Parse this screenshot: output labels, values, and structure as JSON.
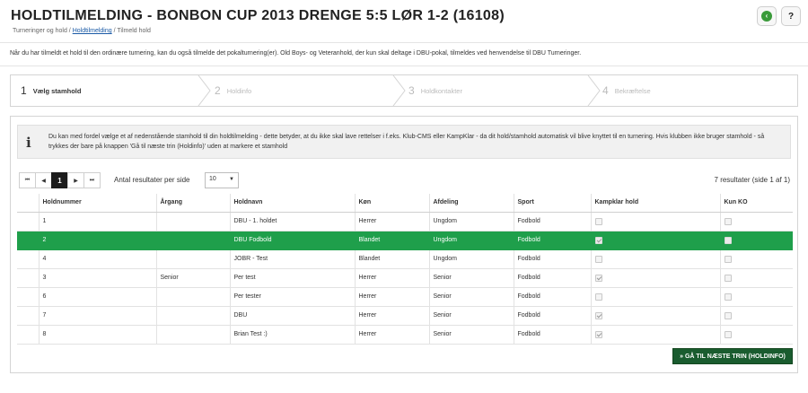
{
  "title": "HOLDTILMELDING - BONBON CUP 2013 DRENGE 5:5 LØR 1-2 (16108)",
  "breadcrumb": {
    "part1": "Turneringer og hold",
    "sep1": " / ",
    "link": "Holdtilmelding",
    "sep2": " / ",
    "current": "Tilmeld hold"
  },
  "top_buttons": {
    "back_icon": "back-arrow-icon",
    "help": "?"
  },
  "info_text": "Når du har tilmeldt et hold til den ordinære turnering, kan du også tilmelde det pokalturnering(er). Old Boys- og Veteranhold, der kun skal deltage i DBU-pokal, tilmeldes ved henvendelse til DBU Turneringer.",
  "wizard": {
    "steps": [
      {
        "num": "1",
        "label": "Vælg stamhold",
        "active": true
      },
      {
        "num": "2",
        "label": "Holdinfo",
        "active": false
      },
      {
        "num": "3",
        "label": "Holdkontakter",
        "active": false
      },
      {
        "num": "4",
        "label": "Bekræftelse",
        "active": false
      }
    ]
  },
  "notice": {
    "icon": "info-icon",
    "text": "Du kan med fordel vælge et af nedenstående stamhold til din holdtilmelding - dette betyder, at du ikke skal lave rettelser i f.eks. Klub-CMS eller KampKlar - da dit hold/stamhold automatisk vil blive knyttet til en turnering. Hvis klubben ikke bruger stamhold - så trykkes der bare på knappen 'Gå til næste trin (Holdinfo)' uden at markere et stamhold"
  },
  "pager": {
    "first": "⏮",
    "prev": "◀",
    "current": "1",
    "next": "▶",
    "last": "⏭",
    "per_page_label": "Antal resultater per side",
    "per_page_value": "10",
    "results": "7 resultater (side 1 af 1)"
  },
  "table": {
    "columns": [
      "Holdnummer",
      "Årgang",
      "Holdnavn",
      "Køn",
      "Afdeling",
      "Sport",
      "Kampklar hold",
      "Kun KO"
    ],
    "rows": [
      {
        "holdnummer": "1",
        "argang": "",
        "holdnavn": "DBU - 1. holdet",
        "kon": "Herrer",
        "afdeling": "Ungdom",
        "sport": "Fodbold",
        "kampklar": false,
        "kunko": false,
        "selected": false
      },
      {
        "holdnummer": "2",
        "argang": "",
        "holdnavn": "DBU Fodbold",
        "kon": "Blandet",
        "afdeling": "Ungdom",
        "sport": "Fodbold",
        "kampklar": true,
        "kunko": false,
        "selected": true
      },
      {
        "holdnummer": "4",
        "argang": "",
        "holdnavn": "JOBR - Test",
        "kon": "Blandet",
        "afdeling": "Ungdom",
        "sport": "Fodbold",
        "kampklar": false,
        "kunko": false,
        "selected": false
      },
      {
        "holdnummer": "3",
        "argang": "Senior",
        "holdnavn": "Per test",
        "kon": "Herrer",
        "afdeling": "Senior",
        "sport": "Fodbold",
        "kampklar": true,
        "kunko": false,
        "selected": false
      },
      {
        "holdnummer": "6",
        "argang": "",
        "holdnavn": "Per tester",
        "kon": "Herrer",
        "afdeling": "Senior",
        "sport": "Fodbold",
        "kampklar": false,
        "kunko": false,
        "selected": false
      },
      {
        "holdnummer": "7",
        "argang": "",
        "holdnavn": "DBU",
        "kon": "Herrer",
        "afdeling": "Senior",
        "sport": "Fodbold",
        "kampklar": true,
        "kunko": false,
        "selected": false
      },
      {
        "holdnummer": "8",
        "argang": "",
        "holdnavn": "Brian Test :)",
        "kon": "Herrer",
        "afdeling": "Senior",
        "sport": "Fodbold",
        "kampklar": true,
        "kunko": false,
        "selected": false
      }
    ]
  },
  "next_button": "» GÅ TIL NÆSTE TRIN (HOLDINFO)",
  "colors": {
    "selected_row": "#1f9f4b",
    "next_button": "#1a5c2f",
    "back_icon": "#3a9a3a"
  }
}
